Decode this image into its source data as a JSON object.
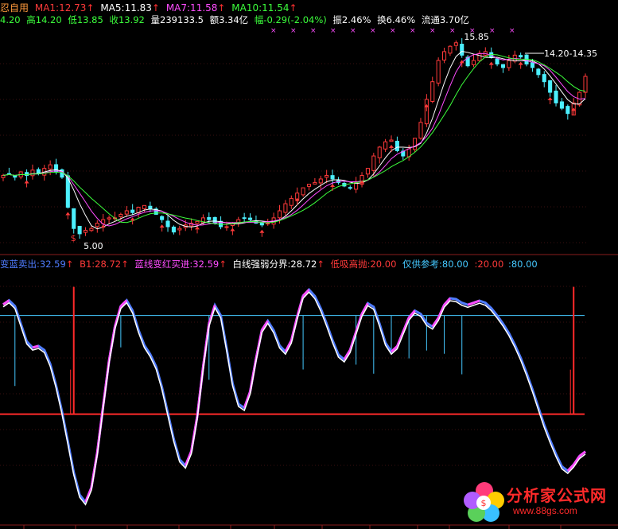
{
  "header": {
    "line1": {
      "prefix": "忍自用",
      "ma": [
        {
          "label": "MA1:12.73",
          "color": "#ff3a3a"
        },
        {
          "label": "MA5:11.83",
          "color": "#ffffff"
        },
        {
          "label": "MA7:11.58",
          "color": "#ff4cff"
        },
        {
          "label": "MA10:11.54",
          "color": "#3cff3c"
        }
      ]
    },
    "line2": {
      "open": "4.20",
      "high": "高14.20",
      "low": "低13.85",
      "close": "收13.92",
      "volume": "量239133.5",
      "amount": "额3.34亿",
      "change": "幅-0.29(-2.04%)",
      "amplitude": "振2.46%",
      "turnover": "换6.46%",
      "float": "流通3.70亿"
    }
  },
  "indicator_header": [
    {
      "text": "变蓝卖出:32.59",
      "color": "#4f7cff",
      "arrow": true
    },
    {
      "text": "B1:28.72",
      "color": "#ff3a3a",
      "arrow": true
    },
    {
      "text": "蓝线变红买进:32.59",
      "color": "#ff4cff",
      "arrow": true
    },
    {
      "text": "白线强弱分界:28.72",
      "color": "#ffffff",
      "arrow": true
    },
    {
      "text": "低吸高抛:20.00",
      "color": "#ff3a3a",
      "arrow": false
    },
    {
      "text": "仅供参考:80.00",
      "color": "#45c8ff",
      "arrow": false
    },
    {
      "text": ":20.00",
      "color": "#ff3a3a",
      "arrow": false
    },
    {
      "text": ":80.00",
      "color": "#45c8ff",
      "arrow": false
    }
  ],
  "annotations": {
    "high_label": "15.85",
    "low_label": "5.00",
    "range_label": "14.20-14.35",
    "signal_mark": "$"
  },
  "watermark": {
    "title": "分析家公式网",
    "url": "www.88gs.com"
  },
  "chart_data": [
    {
      "type": "candlestick",
      "title": "",
      "series": [
        {
          "name": "MA1",
          "color": "#ff3a3a"
        },
        {
          "name": "MA5",
          "color": "#ffffff"
        },
        {
          "name": "MA7",
          "color": "#ff4cff"
        },
        {
          "name": "MA10",
          "color": "#3cff3c"
        }
      ],
      "close": [
        8.3,
        8.4,
        8.2,
        8.5,
        8.3,
        8.6,
        8.4,
        8.7,
        8.9,
        8.5,
        8.2,
        6.5,
        5.3,
        5.0,
        5.2,
        5.3,
        5.6,
        5.8,
        5.9,
        5.9,
        6.1,
        6.3,
        6.2,
        6.5,
        6.6,
        6.4,
        6.1,
        5.8,
        5.4,
        5.1,
        5.3,
        5.5,
        5.6,
        5.7,
        5.9,
        5.8,
        5.6,
        5.4,
        5.4,
        5.6,
        5.8,
        5.9,
        5.8,
        5.6,
        5.5,
        5.6,
        5.9,
        6.3,
        6.7,
        7.0,
        7.3,
        7.6,
        7.8,
        7.9,
        8.1,
        8.3,
        8.1,
        7.9,
        7.7,
        7.6,
        7.9,
        8.3,
        8.7,
        9.4,
        9.9,
        10.2,
        10.3,
        9.7,
        9.4,
        9.8,
        10.4,
        11.3,
        12.6,
        13.6,
        14.8,
        15.3,
        15.6,
        15.8,
        15.1,
        14.5,
        14.8,
        15.2,
        15.3,
        15.0,
        14.6,
        14.4,
        14.8,
        15.1,
        15.0,
        14.6,
        14.4,
        14.0,
        13.6,
        13.0,
        12.4,
        12.1,
        11.8,
        12.4,
        13.0,
        13.9
      ],
      "ylim": [
        4.5,
        16.6
      ],
      "grid": false,
      "legend": "top-left"
    },
    {
      "type": "line",
      "title": "",
      "series": [
        {
          "name": "蓝线",
          "color": "#4f7cff"
        },
        {
          "name": "白线",
          "color": "#ffffff"
        }
      ],
      "values": [
        85,
        92,
        88,
        75,
        62,
        58,
        64,
        60,
        52,
        38,
        22,
        5,
        -18,
        -30,
        -38,
        -28,
        -5,
        25,
        55,
        75,
        88,
        92,
        85,
        70,
        60,
        58,
        50,
        38,
        20,
        5,
        -10,
        -15,
        -5,
        15,
        50,
        80,
        90,
        85,
        60,
        35,
        25,
        20,
        30,
        55,
        75,
        80,
        72,
        60,
        55,
        62,
        80,
        95,
        98,
        92,
        85,
        75,
        65,
        55,
        50,
        58,
        70,
        82,
        90,
        88,
        75,
        62,
        55,
        60,
        70,
        80,
        85,
        82,
        75,
        70,
        78,
        88,
        92,
        90,
        88,
        85,
        88,
        90,
        88,
        85,
        80,
        75,
        70,
        62,
        55,
        45,
        35,
        25,
        12,
        5,
        -5,
        -12,
        -18,
        -10,
        -5,
        -2
      ],
      "reference_lines": [
        20,
        80
      ],
      "ylim": [
        -45,
        105
      ],
      "grid": false,
      "legend": "top-left"
    }
  ]
}
